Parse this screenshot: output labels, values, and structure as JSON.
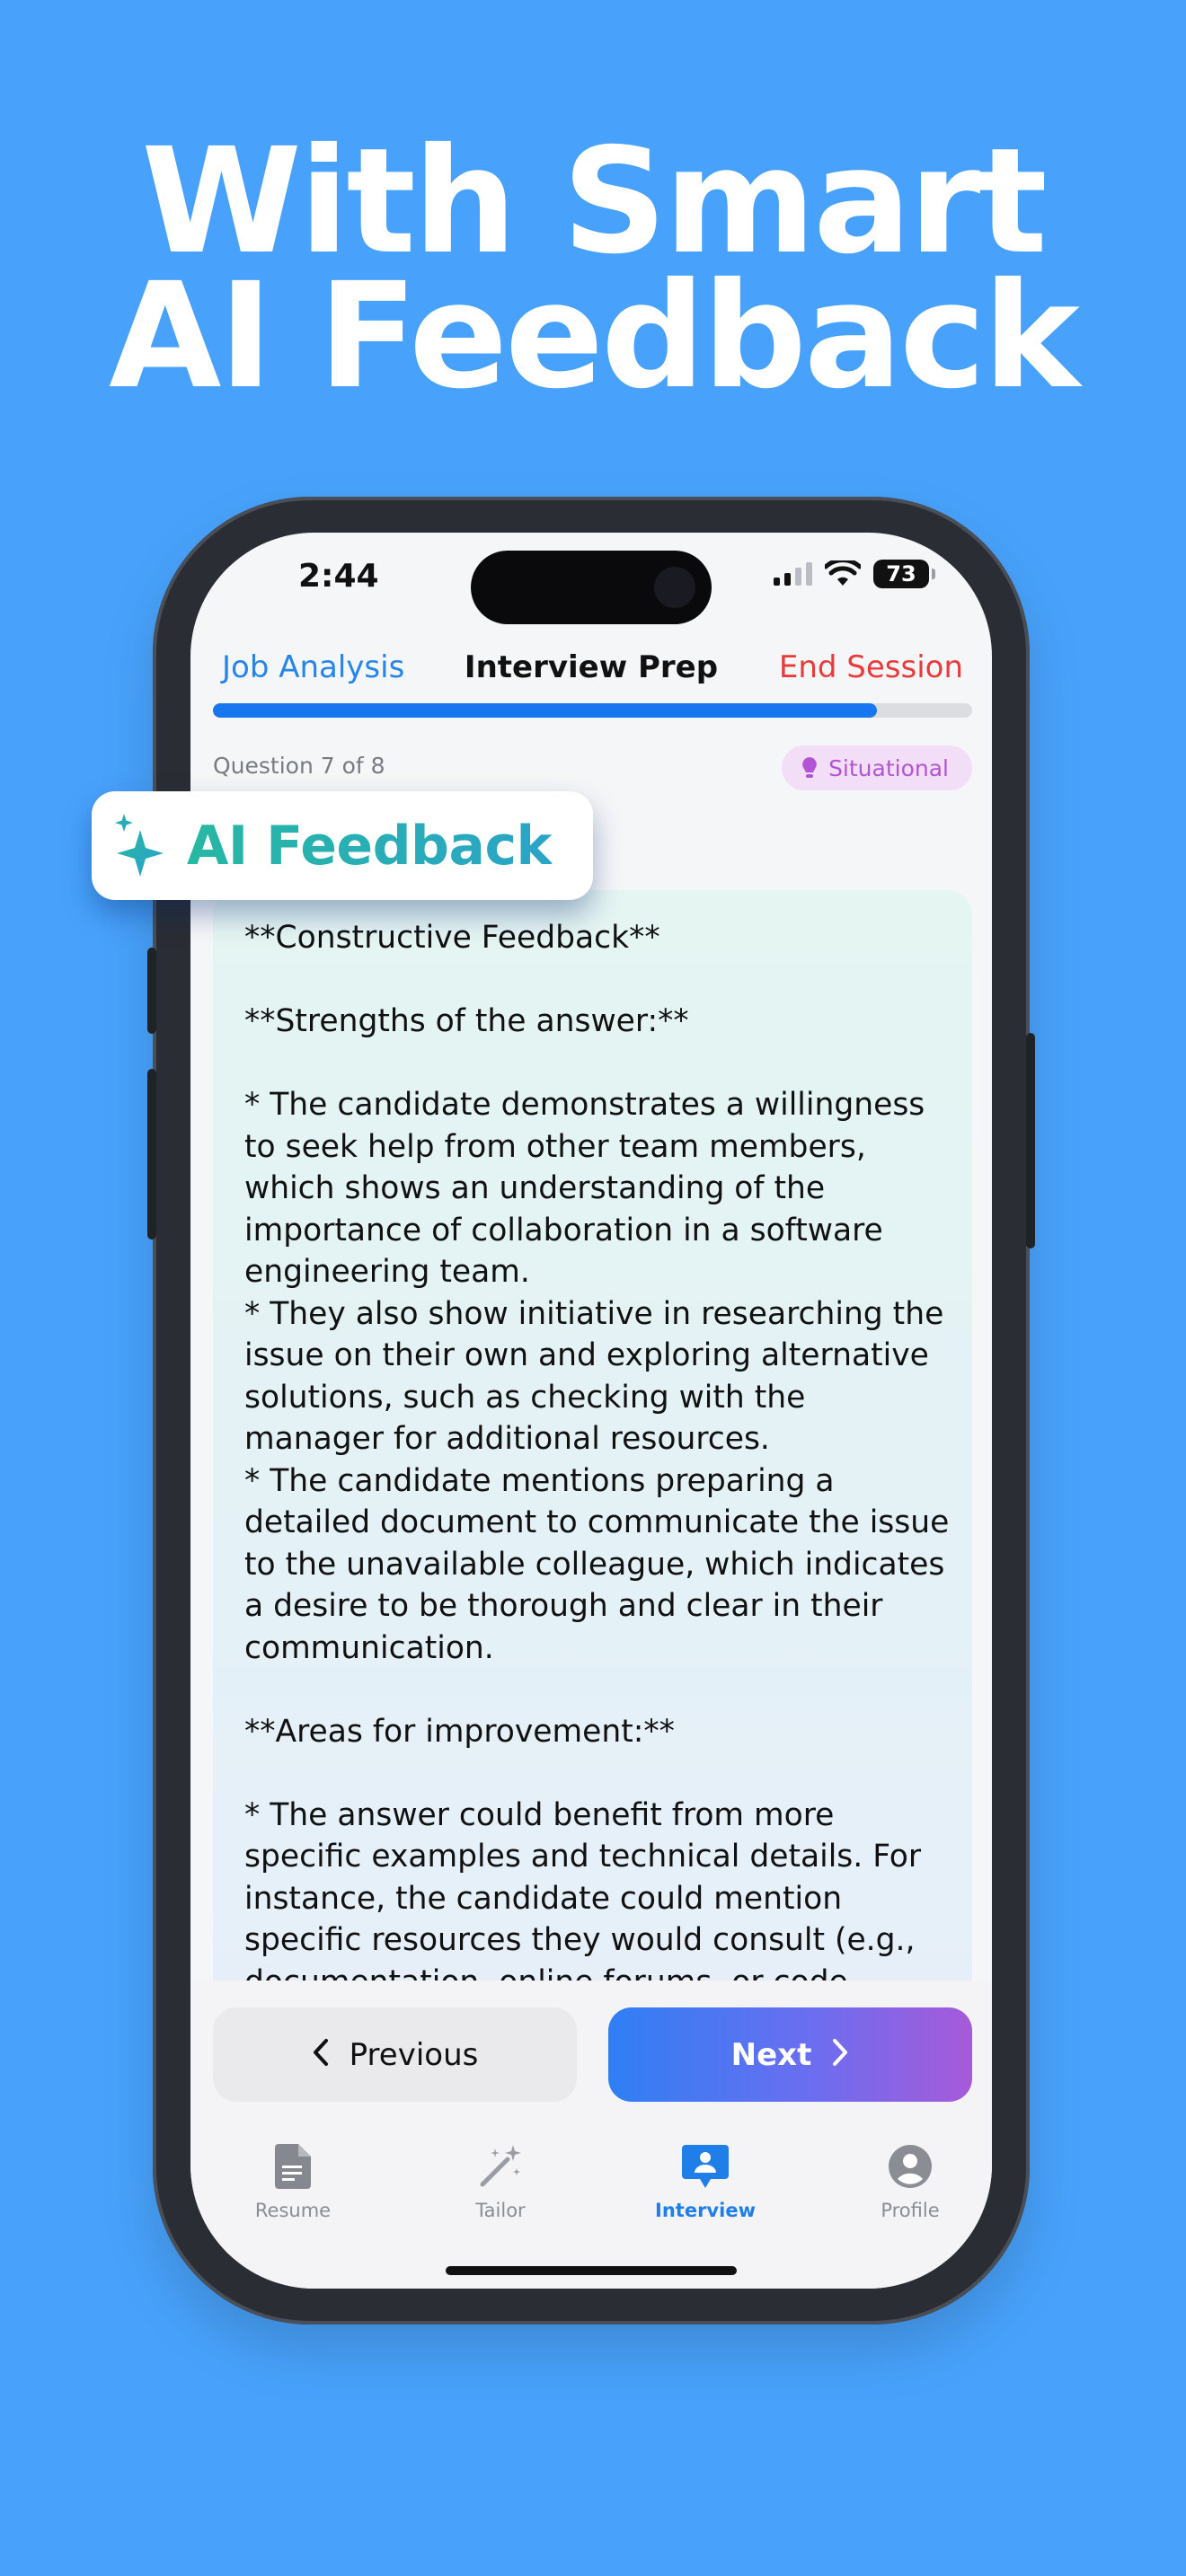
{
  "headline": {
    "line1": "With Smart",
    "line2": "AI Feedback"
  },
  "status_bar": {
    "time": "2:44",
    "battery": "73"
  },
  "nav": {
    "back_label": "Job Analysis",
    "title": "Interview Prep",
    "end_label": "End Session"
  },
  "progress": {
    "fraction": 0.875
  },
  "question": {
    "counter": "Question 7 of 8",
    "category": "Situational",
    "category_icon": "lightbulb-icon"
  },
  "ai_badge": {
    "label": "AI Feedback",
    "icon": "sparkles-icon"
  },
  "feedback": {
    "lines": [
      "**Constructive Feedback**",
      "",
      "**Strengths of the answer:**",
      "",
      "* The candidate demonstrates a willingness to seek help from other team members, which shows an understanding of the importance of collaboration in a software engineering team.",
      "* They also show initiative in researching the issue on their own and exploring alternative solutions, such as checking with the manager for additional resources.",
      "* The candidate mentions preparing a detailed document to communicate the issue to the unavailable colleague, which indicates a desire to be thorough and clear in their communication.",
      "",
      "**Areas for improvement:**",
      "",
      "* The answer could benefit from more specific examples and technical details. For instance, the candidate could mention specific resources they would consult (e.g., documentation, online forums, or code repositories) or technical"
    ]
  },
  "buttons": {
    "previous": "Previous",
    "next": "Next"
  },
  "tabs": [
    {
      "label": "Resume",
      "icon": "document-icon",
      "active": false
    },
    {
      "label": "Tailor",
      "icon": "magic-wand-icon",
      "active": false
    },
    {
      "label": "Interview",
      "icon": "chat-person-icon",
      "active": true
    },
    {
      "label": "Profile",
      "icon": "person-circle-icon",
      "active": false
    }
  ],
  "colors": {
    "background": "#48a2fb",
    "accent": "#1877ee",
    "danger": "#e83b3b",
    "badge": "#b255d4",
    "ai_gradient_start": "#27b8a2"
  }
}
